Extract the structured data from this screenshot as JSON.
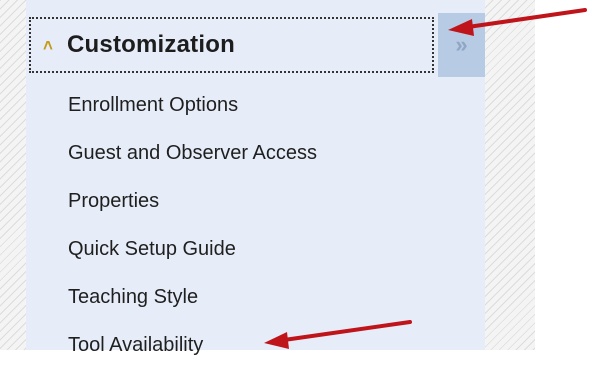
{
  "header": {
    "title": "Customization",
    "collapse_icon": "double-chevron-up-icon",
    "expand_icon": "double-chevron-right-icon"
  },
  "menu": {
    "items": [
      {
        "label": "Enrollment Options"
      },
      {
        "label": "Guest and Observer Access"
      },
      {
        "label": "Properties"
      },
      {
        "label": "Quick Setup Guide"
      },
      {
        "label": "Teaching Style"
      },
      {
        "label": "Tool Availability"
      }
    ]
  },
  "colors": {
    "panel_bg": "#e6edf8",
    "tab_bg": "#b8cbe4",
    "annotation_arrow": "#c0141b",
    "collapse_icon": "#c49a1a"
  }
}
